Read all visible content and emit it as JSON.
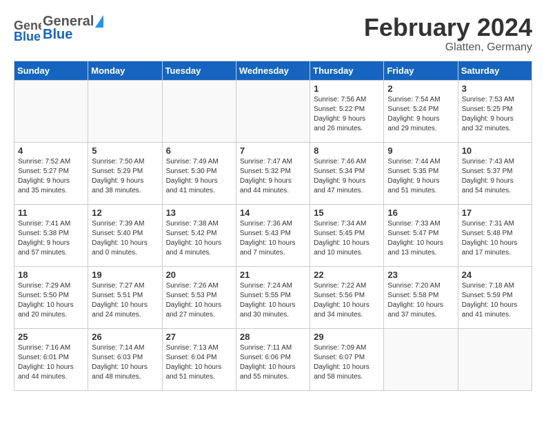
{
  "header": {
    "logo_general": "General",
    "logo_blue": "Blue",
    "title": "February 2024",
    "location": "Glatten, Germany"
  },
  "columns": [
    "Sunday",
    "Monday",
    "Tuesday",
    "Wednesday",
    "Thursday",
    "Friday",
    "Saturday"
  ],
  "weeks": [
    [
      {
        "day": "",
        "info": ""
      },
      {
        "day": "",
        "info": ""
      },
      {
        "day": "",
        "info": ""
      },
      {
        "day": "",
        "info": ""
      },
      {
        "day": "1",
        "info": "Sunrise: 7:56 AM\nSunset: 5:22 PM\nDaylight: 9 hours\nand 26 minutes."
      },
      {
        "day": "2",
        "info": "Sunrise: 7:54 AM\nSunset: 5:24 PM\nDaylight: 9 hours\nand 29 minutes."
      },
      {
        "day": "3",
        "info": "Sunrise: 7:53 AM\nSunset: 5:25 PM\nDaylight: 9 hours\nand 32 minutes."
      }
    ],
    [
      {
        "day": "4",
        "info": "Sunrise: 7:52 AM\nSunset: 5:27 PM\nDaylight: 9 hours\nand 35 minutes."
      },
      {
        "day": "5",
        "info": "Sunrise: 7:50 AM\nSunset: 5:29 PM\nDaylight: 9 hours\nand 38 minutes."
      },
      {
        "day": "6",
        "info": "Sunrise: 7:49 AM\nSunset: 5:30 PM\nDaylight: 9 hours\nand 41 minutes."
      },
      {
        "day": "7",
        "info": "Sunrise: 7:47 AM\nSunset: 5:32 PM\nDaylight: 9 hours\nand 44 minutes."
      },
      {
        "day": "8",
        "info": "Sunrise: 7:46 AM\nSunset: 5:34 PM\nDaylight: 9 hours\nand 47 minutes."
      },
      {
        "day": "9",
        "info": "Sunrise: 7:44 AM\nSunset: 5:35 PM\nDaylight: 9 hours\nand 51 minutes."
      },
      {
        "day": "10",
        "info": "Sunrise: 7:43 AM\nSunset: 5:37 PM\nDaylight: 9 hours\nand 54 minutes."
      }
    ],
    [
      {
        "day": "11",
        "info": "Sunrise: 7:41 AM\nSunset: 5:38 PM\nDaylight: 9 hours\nand 57 minutes."
      },
      {
        "day": "12",
        "info": "Sunrise: 7:39 AM\nSunset: 5:40 PM\nDaylight: 10 hours\nand 0 minutes."
      },
      {
        "day": "13",
        "info": "Sunrise: 7:38 AM\nSunset: 5:42 PM\nDaylight: 10 hours\nand 4 minutes."
      },
      {
        "day": "14",
        "info": "Sunrise: 7:36 AM\nSunset: 5:43 PM\nDaylight: 10 hours\nand 7 minutes."
      },
      {
        "day": "15",
        "info": "Sunrise: 7:34 AM\nSunset: 5:45 PM\nDaylight: 10 hours\nand 10 minutes."
      },
      {
        "day": "16",
        "info": "Sunrise: 7:33 AM\nSunset: 5:47 PM\nDaylight: 10 hours\nand 13 minutes."
      },
      {
        "day": "17",
        "info": "Sunrise: 7:31 AM\nSunset: 5:48 PM\nDaylight: 10 hours\nand 17 minutes."
      }
    ],
    [
      {
        "day": "18",
        "info": "Sunrise: 7:29 AM\nSunset: 5:50 PM\nDaylight: 10 hours\nand 20 minutes."
      },
      {
        "day": "19",
        "info": "Sunrise: 7:27 AM\nSunset: 5:51 PM\nDaylight: 10 hours\nand 24 minutes."
      },
      {
        "day": "20",
        "info": "Sunrise: 7:26 AM\nSunset: 5:53 PM\nDaylight: 10 hours\nand 27 minutes."
      },
      {
        "day": "21",
        "info": "Sunrise: 7:24 AM\nSunset: 5:55 PM\nDaylight: 10 hours\nand 30 minutes."
      },
      {
        "day": "22",
        "info": "Sunrise: 7:22 AM\nSunset: 5:56 PM\nDaylight: 10 hours\nand 34 minutes."
      },
      {
        "day": "23",
        "info": "Sunrise: 7:20 AM\nSunset: 5:58 PM\nDaylight: 10 hours\nand 37 minutes."
      },
      {
        "day": "24",
        "info": "Sunrise: 7:18 AM\nSunset: 5:59 PM\nDaylight: 10 hours\nand 41 minutes."
      }
    ],
    [
      {
        "day": "25",
        "info": "Sunrise: 7:16 AM\nSunset: 6:01 PM\nDaylight: 10 hours\nand 44 minutes."
      },
      {
        "day": "26",
        "info": "Sunrise: 7:14 AM\nSunset: 6:03 PM\nDaylight: 10 hours\nand 48 minutes."
      },
      {
        "day": "27",
        "info": "Sunrise: 7:13 AM\nSunset: 6:04 PM\nDaylight: 10 hours\nand 51 minutes."
      },
      {
        "day": "28",
        "info": "Sunrise: 7:11 AM\nSunset: 6:06 PM\nDaylight: 10 hours\nand 55 minutes."
      },
      {
        "day": "29",
        "info": "Sunrise: 7:09 AM\nSunset: 6:07 PM\nDaylight: 10 hours\nand 58 minutes."
      },
      {
        "day": "",
        "info": ""
      },
      {
        "day": "",
        "info": ""
      }
    ]
  ]
}
